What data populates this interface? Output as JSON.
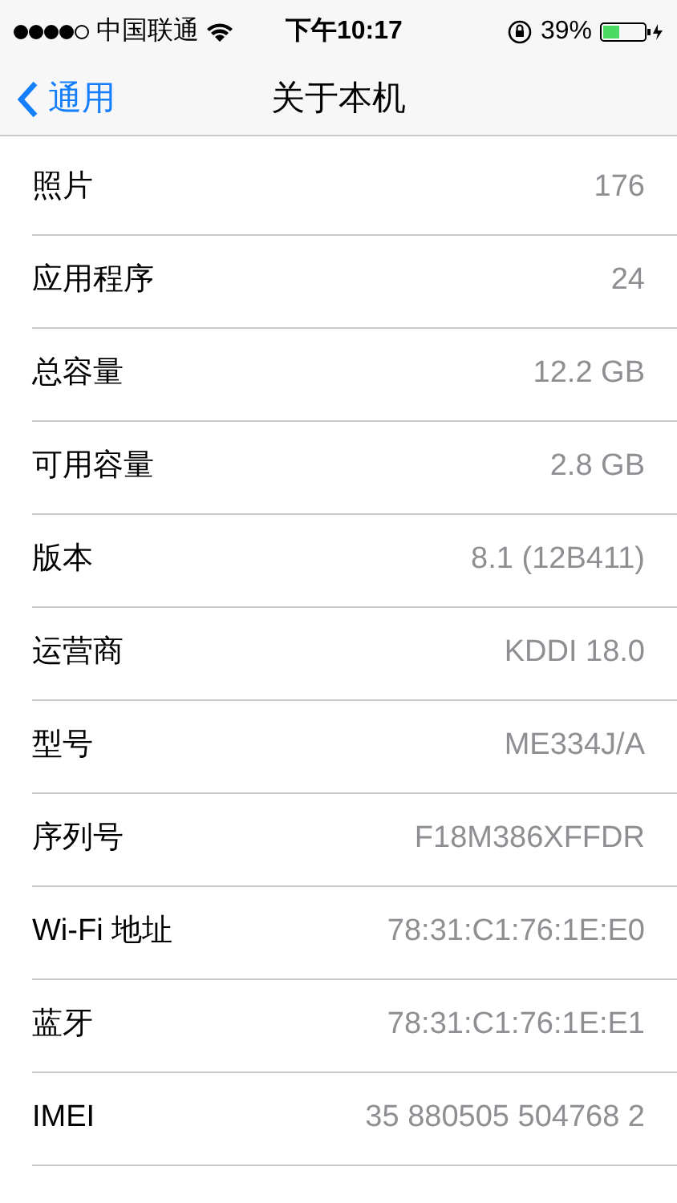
{
  "status_bar": {
    "carrier": "中国联通",
    "time": "下午10:17",
    "battery": "39%"
  },
  "nav": {
    "back": "通用",
    "title": "关于本机"
  },
  "rows": [
    {
      "label": "照片",
      "value": "176"
    },
    {
      "label": "应用程序",
      "value": "24"
    },
    {
      "label": "总容量",
      "value": "12.2 GB"
    },
    {
      "label": "可用容量",
      "value": "2.8 GB"
    },
    {
      "label": "版本",
      "value": "8.1 (12B411)"
    },
    {
      "label": "运营商",
      "value": "KDDI 18.0"
    },
    {
      "label": "型号",
      "value": "ME334J/A"
    },
    {
      "label": "序列号",
      "value": "F18M386XFFDR"
    },
    {
      "label": "Wi-Fi 地址",
      "value": "78:31:C1:76:1E:E0"
    },
    {
      "label": "蓝牙",
      "value": "78:31:C1:76:1E:E1"
    },
    {
      "label": "IMEI",
      "value": "35 880505 504768 2"
    }
  ]
}
